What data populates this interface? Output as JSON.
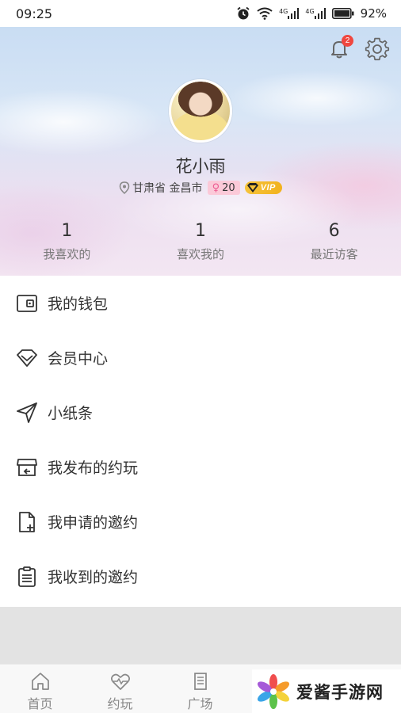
{
  "status_bar": {
    "time": "09:25",
    "signal_1": "4G",
    "signal_2": "4G",
    "battery": "92%"
  },
  "header": {
    "notification_count": "2",
    "username": "花小雨",
    "location": "甘肃省 金昌市",
    "age": "20",
    "vip_label": "VIP",
    "stats": [
      {
        "value": "1",
        "label": "我喜欢的"
      },
      {
        "value": "1",
        "label": "喜欢我的"
      },
      {
        "value": "6",
        "label": "最近访客"
      }
    ]
  },
  "menu": {
    "items": [
      {
        "label": "我的钱包",
        "icon": "wallet-icon"
      },
      {
        "label": "会员中心",
        "icon": "diamond-icon"
      },
      {
        "label": "小纸条",
        "icon": "paper-plane-icon"
      },
      {
        "label": "我发布的约玩",
        "icon": "store-icon"
      },
      {
        "label": "我申请的邀约",
        "icon": "document-add-icon"
      },
      {
        "label": "我收到的邀约",
        "icon": "clipboard-icon"
      }
    ]
  },
  "tabbar": {
    "tabs": [
      {
        "label": "首页",
        "icon": "home-icon"
      },
      {
        "label": "约玩",
        "icon": "heartbeat-icon"
      },
      {
        "label": "广场",
        "icon": "square-icon"
      }
    ]
  },
  "watermark": {
    "text": "爱酱手游网"
  },
  "colors": {
    "badge_red": "#f0473f",
    "vip_gold": "#f5c33b",
    "age_pink": "#fbc9d8",
    "footer_gray": "#e3e3e3"
  }
}
